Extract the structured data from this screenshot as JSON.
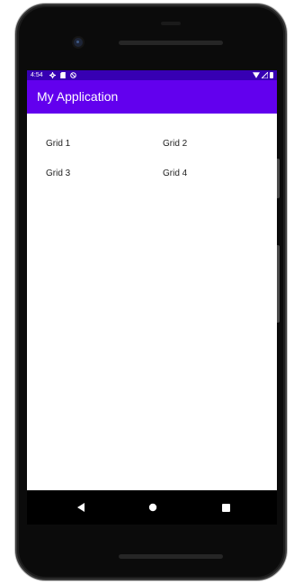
{
  "status_bar": {
    "time": "4:54",
    "left_icons": [
      "settings-icon",
      "sd-card-icon",
      "no-disturb-icon"
    ],
    "right_icons": [
      "wifi-icon",
      "signal-icon",
      "battery-icon"
    ]
  },
  "app_bar": {
    "title": "My Application"
  },
  "grid": {
    "items": [
      "Grid 1",
      "Grid 2",
      "Grid 3",
      "Grid 4"
    ]
  },
  "nav_bar": {
    "buttons": [
      "back-icon",
      "home-icon",
      "recents-icon"
    ]
  },
  "colors": {
    "status_bar": "#3700b3",
    "app_bar": "#6200ee",
    "screen_background": "#ffffff",
    "nav_bar": "#000000",
    "device_body": "#0b0b0b"
  }
}
